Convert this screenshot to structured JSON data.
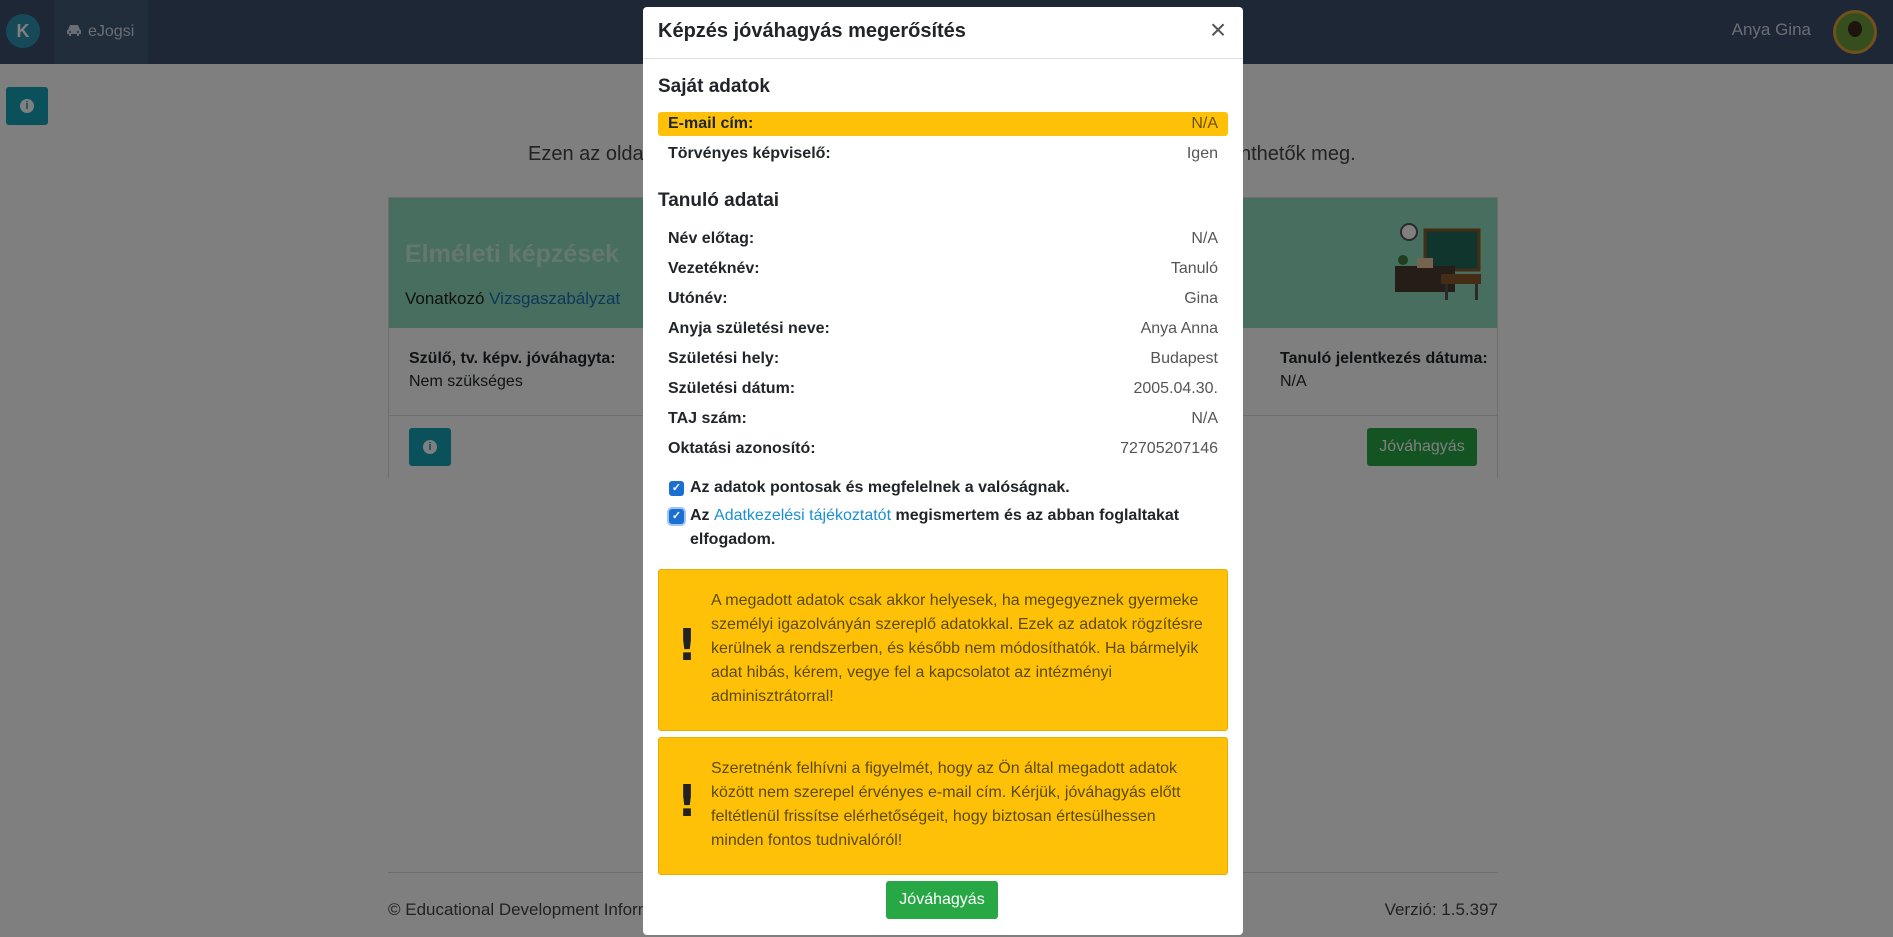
{
  "nav": {
    "brand": "K",
    "tab_label": "eJogsi",
    "user_name": "Anya Gina"
  },
  "page": {
    "intro_left": "Ezen az oldal",
    "intro_right": "nthetők meg.",
    "card": {
      "title": "Elméleti képzések",
      "sub_prefix": "Vonatkozó",
      "sub_link": "Vizsgaszabályzat",
      "field1_label": "Szülő, tv. képv. jóváhagyta:",
      "field1_value": "Nem szükséges",
      "field2_label": "Tanuló jelentkezés dátuma:",
      "field2_value": "N/A",
      "approve_label": "Jóváhagyás"
    },
    "footer_left": "© Educational Development Informa",
    "footer_right": "Verzió: 1.5.397"
  },
  "modal": {
    "title": "Képzés jóváhagyás megerősítés",
    "close_symbol": "×",
    "own_section": "Saját adatok",
    "own_rows": [
      {
        "label": "E-mail cím:",
        "value": "N/A"
      },
      {
        "label": "Törvényes képviselő:",
        "value": "Igen"
      }
    ],
    "student_section": "Tanuló adatai",
    "student_rows": [
      {
        "label": "Név előtag:",
        "value": "N/A"
      },
      {
        "label": "Vezetéknév:",
        "value": "Tanuló"
      },
      {
        "label": "Utónév:",
        "value": "Gina"
      },
      {
        "label": "Anyja születési neve:",
        "value": "Anya Anna"
      },
      {
        "label": "Születési hely:",
        "value": "Budapest"
      },
      {
        "label": "Születési dátum:",
        "value": "2005.04.30."
      },
      {
        "label": "TAJ szám:",
        "value": "N/A"
      },
      {
        "label": "Oktatási azonosító:",
        "value": "72705207146"
      }
    ],
    "check1": "Az adatok pontosak és megfelelnek a valóságnak.",
    "check2_prefix": "Az",
    "check2_link": "Adatkezelési tájékoztatót",
    "check2_suffix": "megismertem és az abban foglaltakat elfogadom.",
    "alert1": "A megadott adatok csak akkor helyesek, ha megegyeznek gyermeke személyi igazolványán szereplő adatokkal. Ezek az adatok rögzítésre kerülnek a rendszerben, és később nem módosíthatók. Ha bármelyik adat hibás, kérem, vegye fel a kapcsolatot az intézményi adminisztrátorral!",
    "alert2": "Szeretnénk felhívni a figyelmét, hogy az Ön által megadott adatok között nem szerepel érvényes e-mail cím. Kérjük, jóváhagyás előtt feltétlenül frissítse elérhetőségeit, hogy biztosan értesülhessen minden fontos tudnivalóról!",
    "approve_label": "Jóváhagyás"
  },
  "colors": {
    "navbar": "#3b4f6b",
    "info_button": "#17a2b8",
    "approve_button": "#28a745",
    "warning": "#ffc107"
  },
  "icons": [
    "car-icon",
    "info-icon",
    "close-icon",
    "exclamation-icon",
    "check-icon"
  ]
}
